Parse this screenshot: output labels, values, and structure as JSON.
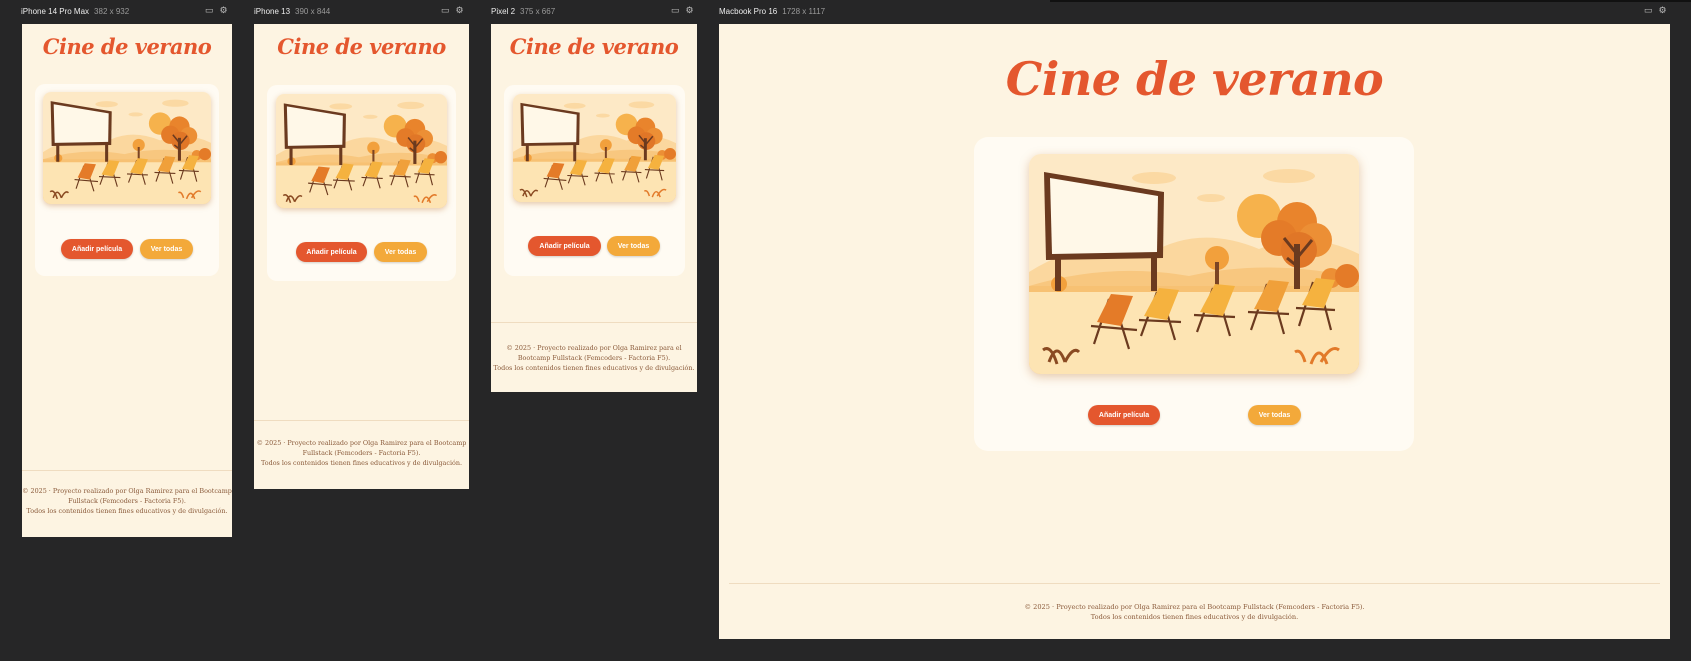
{
  "devices": [
    {
      "name": "iPhone 14 Pro Max",
      "size": "382 x 932"
    },
    {
      "name": "iPhone 13",
      "size": "390 x 844"
    },
    {
      "name": "Pixel 2",
      "size": "375 x 667"
    },
    {
      "name": "Macbook Pro 16",
      "size": "1728 x 1117"
    }
  ],
  "site": {
    "title": "Cine de verano",
    "add_button": "Añadir película",
    "view_button": "Ver todas",
    "footer_line1": "© 2025 · Proyecto realizado por Olga Ramirez para el Bootcamp Fullstack (Femcoders - Factoria F5).",
    "footer_line2": "Todos los contenidos tienen fines educativos y de divulgación.",
    "footer_mobile_a1": "© 2025 · Proyecto realizado por Olga Ramirez para el Bootcamp",
    "footer_mobile_a2": "Fullstack (Femcoders - Factoria F5).",
    "footer_pixel_1": "© 2025 · Proyecto realizado por Olga Ramirez para el",
    "footer_pixel_2": "Bootcamp Fullstack (Femcoders - Factoria F5).",
    "hero_alt": "Ilustración de cine al aire libre con pantalla, tumbonas y árboles otoñales"
  },
  "colors": {
    "page_bg": "#fdf4e2",
    "accent": "#e4572e",
    "secondary": "#f3a93a",
    "footer_text": "#8a5a3a"
  },
  "icons": [
    "device-frame-icon",
    "settings-gear-icon"
  ]
}
